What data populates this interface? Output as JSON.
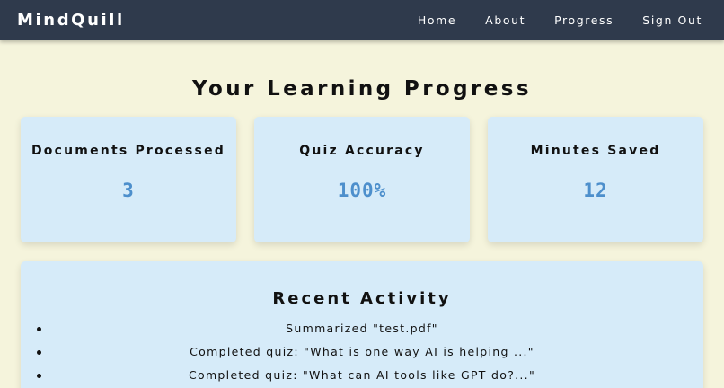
{
  "navbar": {
    "logo": "MindQuill",
    "links": [
      {
        "label": "Home"
      },
      {
        "label": "About"
      },
      {
        "label": "Progress"
      },
      {
        "label": "Sign Out"
      }
    ]
  },
  "page": {
    "title": "Your Learning Progress"
  },
  "stats": [
    {
      "label": "Documents Processed",
      "value": "3"
    },
    {
      "label": "Quiz Accuracy",
      "value": "100%"
    },
    {
      "label": "Minutes Saved",
      "value": "12"
    }
  ],
  "activity": {
    "title": "Recent Activity",
    "items": [
      "Summarized \"test.pdf\"",
      "Completed quiz: \"What is one way AI is helping ...\"",
      "Completed quiz: \"What can AI tools like GPT do?...\""
    ]
  },
  "colors": {
    "navbar_bg": "#2f3a4c",
    "page_bg": "#f5f4dc",
    "card_bg": "#d6ebf9",
    "accent": "#4d8fcc"
  }
}
